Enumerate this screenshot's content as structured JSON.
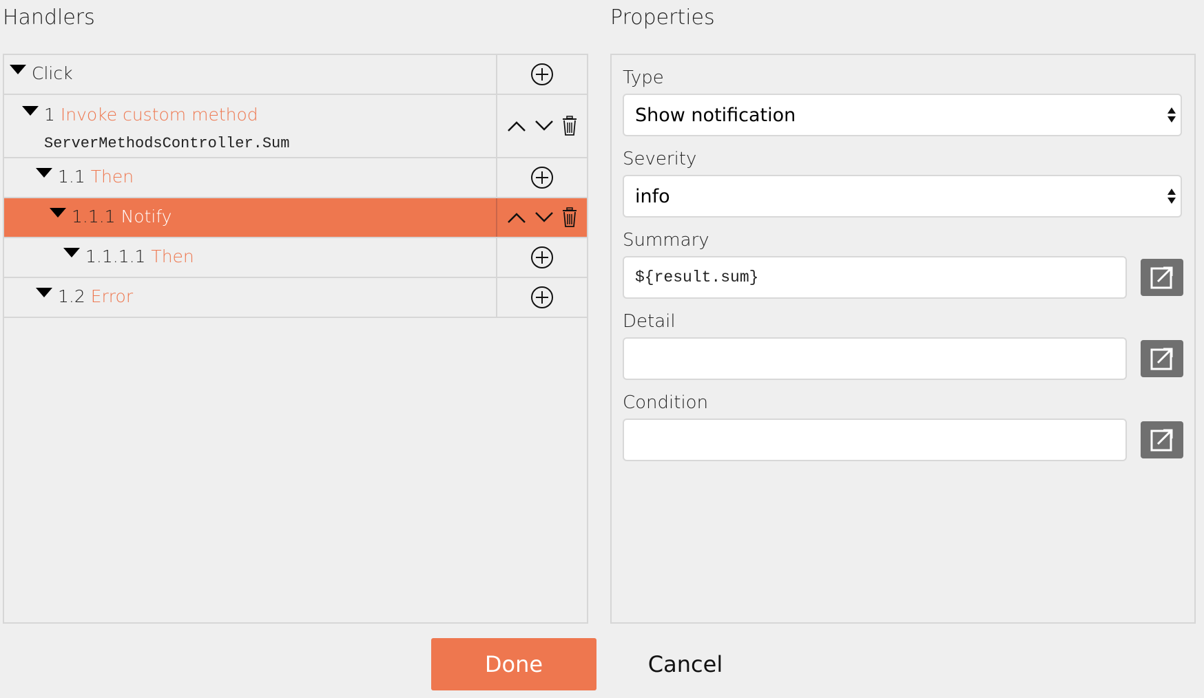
{
  "handlers": {
    "title": "Handlers",
    "rows": [
      {
        "num": "",
        "kind": "",
        "text": "Click"
      },
      {
        "num": "1",
        "kind": "Invoke custom method",
        "sub": "ServerMethodsController.Sum"
      },
      {
        "num": "1.1",
        "kind": "Then"
      },
      {
        "num": "1.1.1",
        "kind": "Notify"
      },
      {
        "num": "1.1.1.1",
        "kind": "Then"
      },
      {
        "num": "1.2",
        "kind": "Error"
      }
    ],
    "selected_index": 3
  },
  "properties": {
    "title": "Properties",
    "type": {
      "label": "Type",
      "value": "Show notification"
    },
    "severity": {
      "label": "Severity",
      "value": "info"
    },
    "summary": {
      "label": "Summary",
      "value": "${result.sum}"
    },
    "detail": {
      "label": "Detail",
      "value": ""
    },
    "condition": {
      "label": "Condition",
      "value": ""
    }
  },
  "buttons": {
    "done": "Done",
    "cancel": "Cancel"
  },
  "colors": {
    "accent": "#ee774f",
    "panel_border": "#d6d6d6",
    "external_button": "#707070"
  },
  "icons": {
    "add": "plus-circle-icon",
    "move_up": "chevron-up-icon",
    "move_down": "chevron-down-icon",
    "delete": "trash-icon",
    "expand": "caret-down-icon",
    "open_editor": "external-edit-icon"
  }
}
